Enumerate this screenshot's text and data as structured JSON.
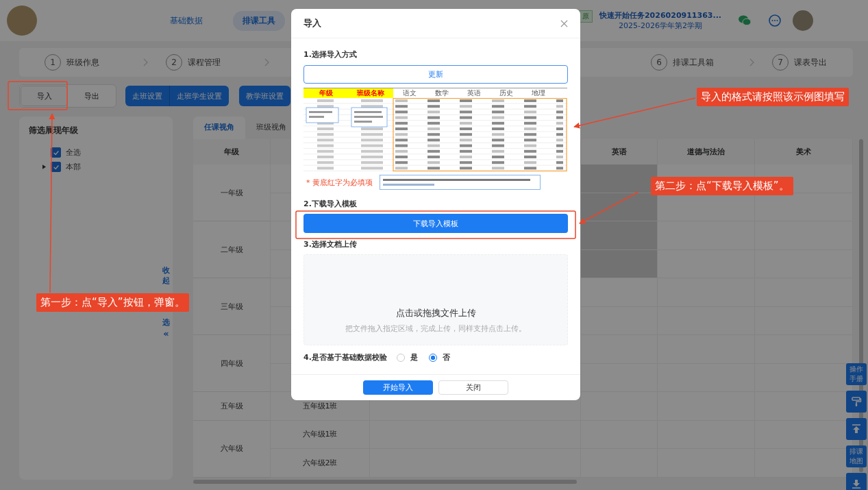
{
  "top_bar": {
    "nav": [
      {
        "label": "基础数据",
        "selected": false
      },
      {
        "label": "排课工具",
        "selected": true
      }
    ],
    "task_badge": "原",
    "task_title": "快速开始任务2026020911363...",
    "term": "2025-2026学年第2学期"
  },
  "steps": [
    {
      "number": "1",
      "label": "班级作息"
    },
    {
      "number": "2",
      "label": "课程管理"
    },
    {
      "number": "6",
      "label": "排课工具箱"
    },
    {
      "number": "7",
      "label": "课表导出"
    }
  ],
  "toolbar": {
    "segments": [
      {
        "label": "导入",
        "selected": true
      },
      {
        "label": "导出",
        "selected": false
      }
    ],
    "actions": [
      "走班设置",
      "走班学生设置",
      "教学班设置"
    ]
  },
  "filter": {
    "title": "筛选展现年级",
    "options": [
      {
        "label": "全选",
        "checked": true,
        "expandable": false
      },
      {
        "label": "本部",
        "checked": true,
        "expandable": true
      }
    ],
    "collapse_top": "收起",
    "collapse_bottom": "选",
    "collapse_icon": "«"
  },
  "view_tabs": [
    {
      "label": "任课视角",
      "selected": true
    },
    {
      "label": "班级视角",
      "selected": false
    }
  ],
  "table": {
    "grade_header": "年级",
    "subject_headers": [
      "英语",
      "道德与法治",
      "美术"
    ],
    "grades": [
      {
        "name": "一年级",
        "shaded": true
      },
      {
        "name": "二年级",
        "shaded": true
      },
      {
        "name": "三年级",
        "shaded": false
      },
      {
        "name": "四年级",
        "shaded": false
      },
      {
        "name": "五年级",
        "shaded": false,
        "classes": [
          "五年级1班"
        ]
      },
      {
        "name": "六年级",
        "shaded": false,
        "classes": [
          "六年级1班",
          "六年级2班"
        ]
      }
    ]
  },
  "side_buttons": [
    {
      "kind": "text",
      "label": "操作手册"
    },
    {
      "kind": "roller"
    },
    {
      "kind": "top"
    },
    {
      "kind": "text",
      "label": "排课地图"
    },
    {
      "kind": "download"
    }
  ],
  "dialog": {
    "title": "导入",
    "step1_label": "1.选择导入方式",
    "mode_button": "更新",
    "example": {
      "headers": [
        {
          "label": "年级",
          "required": true
        },
        {
          "label": "班级名称",
          "required": true
        },
        {
          "label": "语文",
          "required": false
        },
        {
          "label": "数学",
          "required": false
        },
        {
          "label": "英语",
          "required": false
        },
        {
          "label": "历史",
          "required": false
        },
        {
          "label": "地理",
          "required": false
        }
      ],
      "note": "* 黄底红字为必填项"
    },
    "step2_label": "2.下载导入模板",
    "download_button": "下载导入模板",
    "step3_label": "3.选择文档上传",
    "upload_title": "点击或拖拽文件上传",
    "upload_hint": "把文件拖入指定区域，完成上传，同样支持点击上传。",
    "step4_label": "4.是否基于基础数据校验",
    "validate_options": [
      {
        "label": "是",
        "selected": false
      },
      {
        "label": "否",
        "selected": true
      }
    ],
    "primary_button": "开始导入",
    "cancel_button": "关闭"
  },
  "annotations": [
    {
      "kind": "callout",
      "text": "第一步：点“导入”按钮，弹窗。"
    },
    {
      "kind": "callout",
      "text": "导入的格式请按照该示例图填写"
    },
    {
      "kind": "callout",
      "text": "第二步：点“下载导入模板”。"
    }
  ]
}
